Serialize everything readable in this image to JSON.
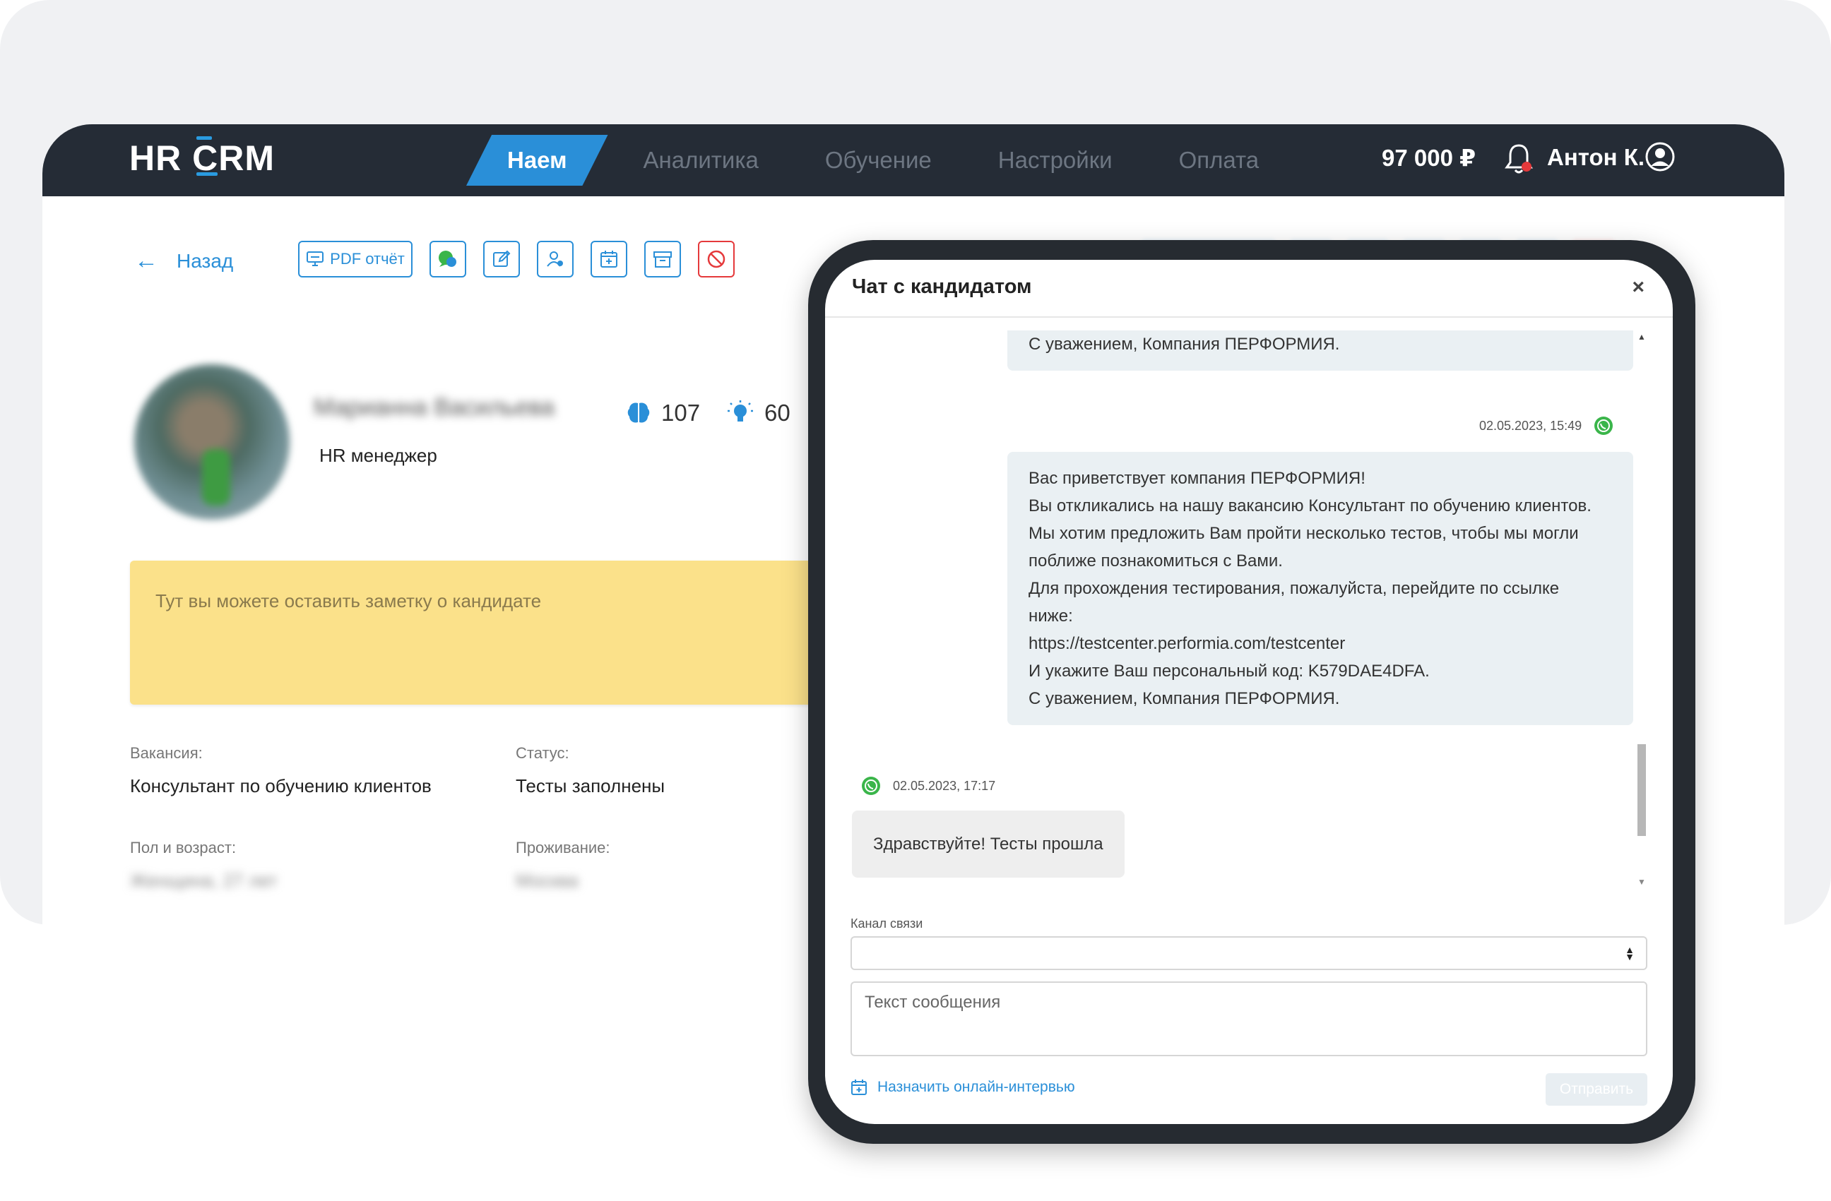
{
  "brand": {
    "logo_text_1": "HR ",
    "logo_text_c": "C",
    "logo_text_2": "RM",
    "accent": "#2a8fd8",
    "header_bg": "#252c36"
  },
  "nav": {
    "items": [
      "Наем",
      "Аналитика",
      "Обучение",
      "Настройки",
      "Оплата"
    ],
    "active": 0
  },
  "header": {
    "balance": "97 000 ₽",
    "user_name": "Антон К."
  },
  "toolbar": {
    "back_label": "Назад",
    "pdf_label": "PDF отчёт",
    "icons": [
      "monitor-icon",
      "whatsapp-chat-icon",
      "edit-icon",
      "user-assign-icon",
      "calendar-add-icon",
      "archive-icon",
      "ban-icon"
    ]
  },
  "candidate": {
    "name": "Марианна Васильева",
    "position": "HR менеджер",
    "score_brain": "107",
    "score_idea": "60"
  },
  "note": {
    "placeholder": "Тут вы можете оставить заметку о кандидате"
  },
  "fields": {
    "vacancy_label": "Вакансия:",
    "vacancy_value": "Консультант по обучению клиентов",
    "status_label": "Статус:",
    "status_value": "Тесты заполнены",
    "gender_age_label": "Пол и возраст:",
    "gender_age_value": "Женщина, 27 лет",
    "residence_label": "Проживание:",
    "residence_value": "Москва"
  },
  "chat": {
    "title": "Чат с кандидатом",
    "close": "×",
    "messages": [
      {
        "direction": "out",
        "text": "С уважением, Компания ПЕРФОРМИЯ."
      },
      {
        "direction": "out",
        "timestamp": "02.05.2023, 15:49",
        "lines": [
          "Вас приветствует компания ПЕРФОРМИЯ!",
          "Вы откликались на нашу вакансию Консультант по обучению клиентов.",
          "Мы хотим предложить Вам пройти несколько тестов, чтобы мы могли",
          "поближе познакомиться с Вами.",
          "Для прохождения тестирования, пожалуйста, перейдите по ссылке",
          "ниже:",
          "https://testcenter.performia.com/testcenter",
          "И укажите Ваш персональный код: K579DAE4DFA.",
          "С уважением, Компания ПЕРФОРМИЯ."
        ]
      },
      {
        "direction": "in",
        "timestamp": "02.05.2023, 17:17",
        "text": "Здравствуйте! Тесты прошла"
      }
    ],
    "channel_label": "Канал связи",
    "channel_value": "",
    "message_placeholder": "Текст сообщения",
    "schedule_label": "Назначить онлайн-интервью",
    "send_label": "Отправить"
  }
}
